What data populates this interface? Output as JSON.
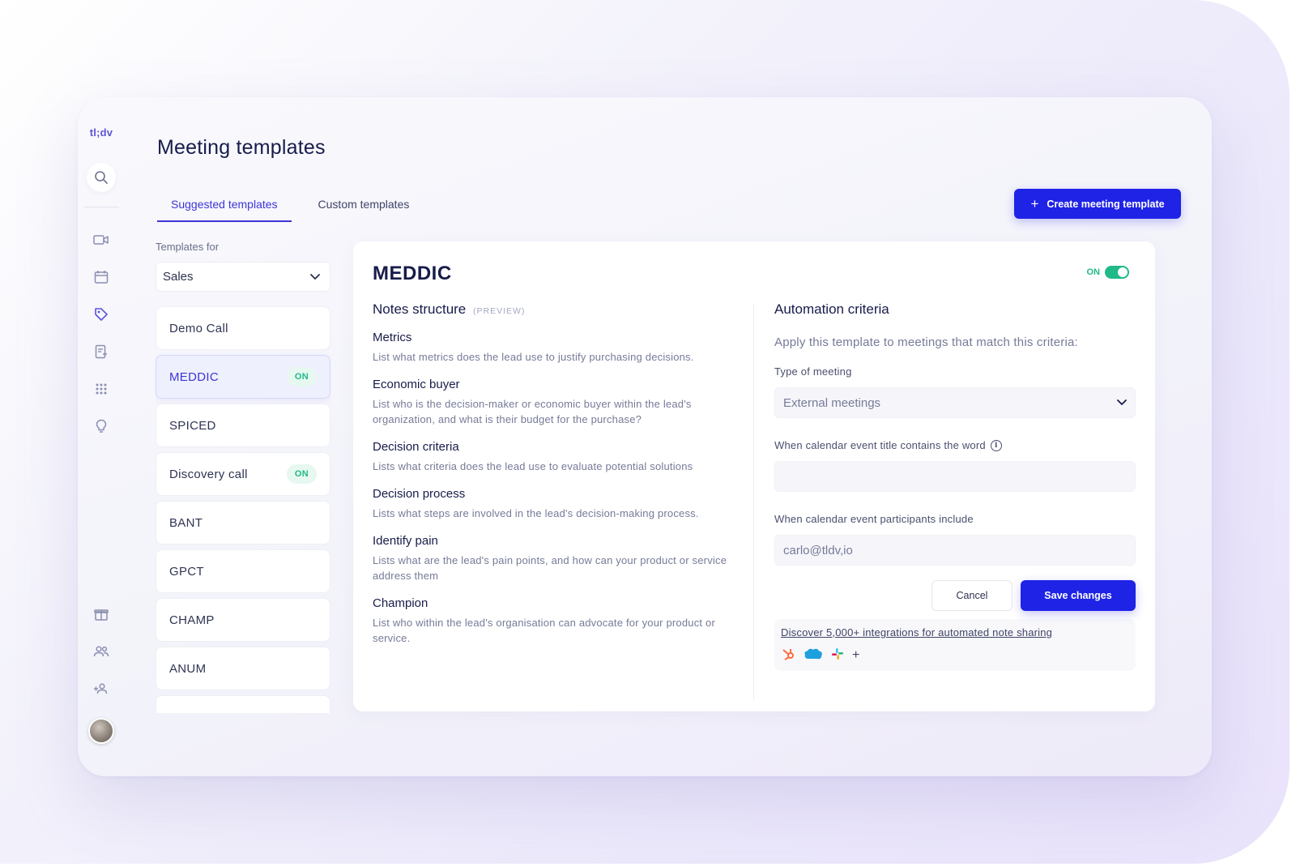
{
  "app": {
    "logo": "tl;dv"
  },
  "sidebar": {
    "icons": [
      "search-icon",
      "video-icon",
      "calendar-icon",
      "tag-icon",
      "notes-icon",
      "apps-grid-icon",
      "lightbulb-icon",
      "gift-icon",
      "team-icon",
      "add-user-icon"
    ],
    "active": "tag-icon"
  },
  "page": {
    "title": "Meeting templates",
    "tabs": [
      {
        "label": "Suggested templates",
        "active": true
      },
      {
        "label": "Custom templates",
        "active": false
      }
    ],
    "create_button": "Create meeting template"
  },
  "templates": {
    "label": "Templates for",
    "selected_category": "Sales",
    "items": [
      {
        "name": "Demo Call",
        "badge": ""
      },
      {
        "name": "MEDDIC",
        "badge": "ON"
      },
      {
        "name": "SPICED",
        "badge": ""
      },
      {
        "name": "Discovery call",
        "badge": "ON"
      },
      {
        "name": "BANT",
        "badge": ""
      },
      {
        "name": "GPCT",
        "badge": ""
      },
      {
        "name": "CHAMP",
        "badge": ""
      },
      {
        "name": "ANUM",
        "badge": ""
      }
    ]
  },
  "detail": {
    "title": "MEDDIC",
    "toggle_label": "ON",
    "notes_heading": "Notes structure",
    "notes_tag": "(PREVIEW)",
    "notes": [
      {
        "title": "Metrics",
        "desc": "List what metrics does the lead use to justify purchasing decisions."
      },
      {
        "title": "Economic buyer",
        "desc": "List who is the decision-maker or economic buyer within the lead's organization, and what is their budget for the purchase?"
      },
      {
        "title": "Decision criteria",
        "desc": "Lists what criteria does the lead use to evaluate potential solutions"
      },
      {
        "title": "Decision process",
        "desc": "Lists what steps are involved in the lead's decision-making process."
      },
      {
        "title": "Identify pain",
        "desc": "Lists what are the lead's pain points, and how can your product or service address them"
      },
      {
        "title": "Champion",
        "desc": "List who within the lead's organisation can advocate for your product or service."
      }
    ],
    "automation": {
      "heading": "Automation criteria",
      "subtitle": "Apply this template to meetings that match this criteria:",
      "type_label": "Type of meeting",
      "type_value": "External meetings",
      "title_label": "When calendar event title contains the word",
      "title_value": "",
      "participants_label": "When calendar event participants include",
      "participants_value": "carlo@tldv,io",
      "cancel": "Cancel",
      "save": "Save changes",
      "integrations_link": "Discover 5,000+ integrations for automated note sharing",
      "integration_icons": [
        "hubspot-icon",
        "salesforce-icon",
        "slack-icon",
        "add-icon"
      ]
    }
  },
  "colors": {
    "accent": "#1f23e6",
    "active_tab": "#3d35d6",
    "on_green": "#21b98a"
  }
}
